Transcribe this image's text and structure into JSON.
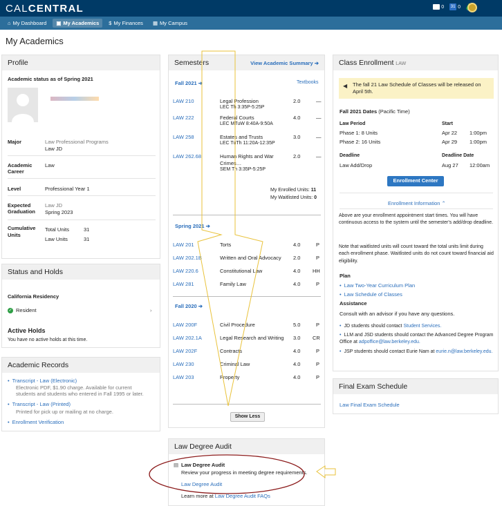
{
  "header": {
    "logo_a": "CAL",
    "logo_b": "CENTRAL",
    "mail_count": "0",
    "cal_count": "0",
    "cal_day": "31"
  },
  "nav": [
    "My Dashboard",
    "My Academics",
    "My Finances",
    "My Campus"
  ],
  "page_title": "My Academics",
  "profile": {
    "title": "Profile",
    "status": "Academic status as of Spring 2021",
    "major_label": "Major",
    "major_v1": "Law Professional Programs",
    "major_v2": "Law JD",
    "career_label1": "Academic",
    "career_label2": "Career",
    "career_v": "Law",
    "level_label": "Level",
    "level_v": "Professional Year 1",
    "grad_label1": "Expected",
    "grad_label2": "Graduation",
    "grad_v1": "Law JD",
    "grad_v2": "Spring 2023",
    "cum_label1": "Cumulative",
    "cum_label2": "Units",
    "total_label": "Total Units",
    "total_v": "31",
    "law_label": "Law Units",
    "law_v": "31"
  },
  "status": {
    "title": "Status and Holds",
    "residency": "California Residency",
    "resident": "Resident",
    "holds_title": "Active Holds",
    "holds_text": "You have no active holds at this time."
  },
  "records": {
    "title": "Academic Records",
    "t1": "Transcript - Law (Electronic)",
    "t1d1": "Electronic PDF, $1.90 charge. Available for current",
    "t1d2": "students and students who entered in Fall 1995 or later.",
    "t2": "Transcript - Law (Printed)",
    "t2d": "Printed for pick up or mailing at no charge.",
    "t3": "Enrollment Verification"
  },
  "semesters": {
    "title": "Semesters",
    "summary": "View Academic Summary ➔",
    "textbooks": "Textbooks",
    "show_less": "Show Less",
    "fall21": "Fall 2021 ➔",
    "spring21": "Spring 2021 ➔",
    "fall20": "Fall 2020 ➔",
    "enrolled_label": "My Enrolled Units:",
    "enrolled_v": "11",
    "wait_label": "My Waitlisted Units:",
    "wait_v": "0",
    "fall21_courses": [
      {
        "code": "LAW 210",
        "title": "Legal Profession",
        "sched": "LEC   Th 3:35P-5:25P",
        "units": "2.0",
        "grade": "—"
      },
      {
        "code": "LAW 222",
        "title": "Federal Courts",
        "sched": "LEC   MTuW 8:40A-9:50A",
        "units": "4.0",
        "grade": "—"
      },
      {
        "code": "LAW 258",
        "title": "Estates and Trusts",
        "sched": "LEC   TuTh 11:20A-12:35P",
        "units": "3.0",
        "grade": "—"
      },
      {
        "code": "LAW 262.68",
        "title": "Human Rights and War",
        "title2": "Crimes…",
        "sched": "SEM   Th 3:35P-5:25P",
        "units": "2.0",
        "grade": "—"
      }
    ],
    "spring21_courses": [
      {
        "code": "LAW 201",
        "title": "Torts",
        "units": "4.0",
        "grade": "P"
      },
      {
        "code": "LAW 202.1B",
        "title": "Written and Oral Advocacy",
        "units": "2.0",
        "grade": "P"
      },
      {
        "code": "LAW 220.6",
        "title": "Constitutional Law",
        "units": "4.0",
        "grade": "HH"
      },
      {
        "code": "LAW 281",
        "title": "Family Law",
        "units": "4.0",
        "grade": "P"
      }
    ],
    "fall20_courses": [
      {
        "code": "LAW 200F",
        "title": "Civil Procedure",
        "units": "5.0",
        "grade": "P"
      },
      {
        "code": "LAW 202.1A",
        "title": "Legal Research and Writing",
        "units": "3.0",
        "grade": "CR"
      },
      {
        "code": "LAW 202F",
        "title": "Contracts",
        "units": "4.0",
        "grade": "P"
      },
      {
        "code": "LAW 230",
        "title": "Criminal Law",
        "units": "4.0",
        "grade": "P"
      },
      {
        "code": "LAW 203",
        "title": "Property",
        "units": "4.0",
        "grade": "P"
      }
    ]
  },
  "audit": {
    "title": "Law Degree Audit",
    "item": "Law Degree Audit",
    "desc": "Review your progress in meeting degree requirements.",
    "link": "Law Degree Audit",
    "more": "Learn more at",
    "more_link": "Law Degree Audit FAQs"
  },
  "enroll": {
    "title": "Class Enrollment",
    "title_sub": "LAW",
    "notice": "The fall 21 Law Schedule of Classes will be released on April 5th.",
    "dates_title": "Fall 2021 Dates",
    "dates_sub": "(Pacific Time)",
    "period_label": "Law Period",
    "start_label": "Start",
    "p1": "Phase 1: 8 Units",
    "p1d": "Apr 22",
    "p1t": "1:00pm",
    "p2": "Phase 2: 16 Units",
    "p2d": "Apr 29",
    "p2t": "1:00pm",
    "deadline_label": "Deadline",
    "deadline_date_label": "Deadline Date",
    "dl": "Law Add/Drop",
    "dld": "Aug 27",
    "dlt": "12:00am",
    "center_btn": "Enrollment Center",
    "info_toggle": "Enrollment Information ⌃",
    "p_a": "Above are your enrollment appointment start times. You will have continuous access to the system until the semester's add/drop deadline.",
    "p_b": "Note that waitlisted units will count toward the total units limit during each enrollment phase. Waitlisted units do not count toward financial aid eligibility.",
    "plan_title": "Plan",
    "plan1": "Law Two-Year Curriculum Plan",
    "plan2": "Law Schedule of Classes",
    "assist_title": "Assistance",
    "assist_text": "Consult with an advisor if you have any questions.",
    "a1": "JD students should contact",
    "a1_link": "Student Services.",
    "a2": "LLM and JSD students should contact the Advanced Degree Program Office at",
    "a2_link": "adpoffice@law.berkeley.edu.",
    "a3": "JSP students should contact Eurie Nam at",
    "a3_link": "eurie.n@law.berkeley.edu."
  },
  "final": {
    "title": "Final Exam Schedule",
    "link": "Law Final Exam Schedule"
  }
}
